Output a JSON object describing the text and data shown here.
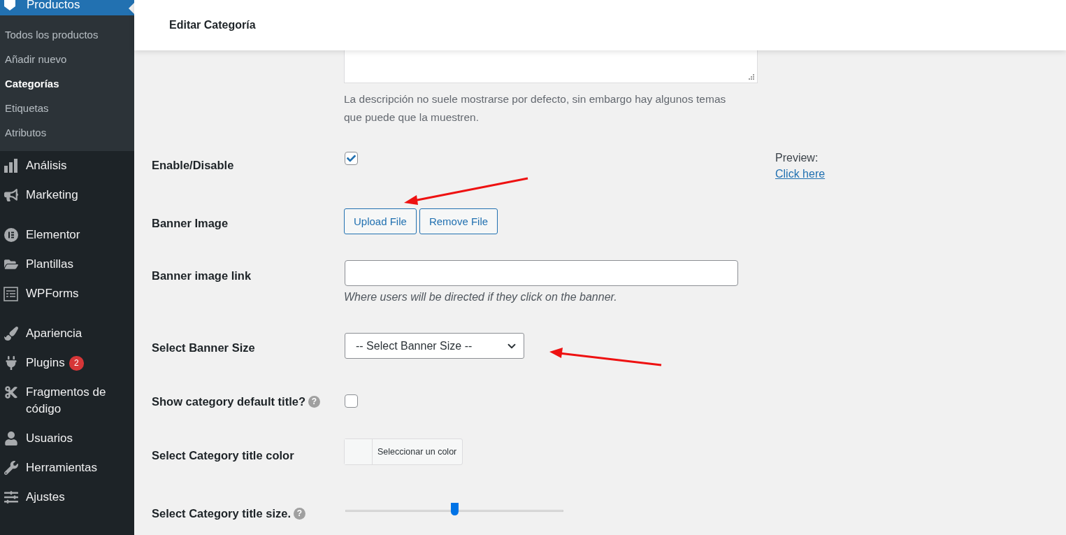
{
  "sidebar": {
    "current": {
      "label": "Productos"
    },
    "submenu": [
      {
        "label": "Todos los productos",
        "selected": false
      },
      {
        "label": "Añadir nuevo",
        "selected": false
      },
      {
        "label": "Categorías",
        "selected": true
      },
      {
        "label": "Etiquetas",
        "selected": false
      },
      {
        "label": "Atributos",
        "selected": false
      }
    ],
    "groups": [
      [
        {
          "label": "Análisis"
        },
        {
          "label": "Marketing"
        }
      ],
      [
        {
          "label": "Elementor"
        },
        {
          "label": "Plantillas"
        },
        {
          "label": "WPForms"
        }
      ],
      [
        {
          "label": "Apariencia"
        },
        {
          "label": "Plugins",
          "badge": "2"
        },
        {
          "label": "Fragmentos de código"
        },
        {
          "label": "Usuarios"
        },
        {
          "label": "Herramientas"
        },
        {
          "label": "Ajustes"
        }
      ]
    ]
  },
  "header": {
    "title": "Editar Categoría"
  },
  "description_hint": "La descripción no suele mostrarse por defecto, sin embargo hay algunos temas que puede que la muestren.",
  "fields": [
    {
      "kind": "checkbox",
      "label": "Enable/Disable",
      "checked": true,
      "preview": {
        "label": "Preview:",
        "link": "Click here"
      }
    },
    {
      "kind": "buttons",
      "label": "Banner Image",
      "buttons": [
        "Upload File",
        "Remove File"
      ]
    },
    {
      "kind": "text",
      "label": "Banner image link",
      "hint": "Where users will be directed if they click on the banner."
    },
    {
      "kind": "select",
      "label": "Select Banner Size",
      "value": "-- Select Banner Size --"
    },
    {
      "kind": "checkbox",
      "label": "Show category default title?",
      "help": "?",
      "checked": false
    },
    {
      "kind": "color",
      "label": "Select Category title color",
      "button": "Seleccionar un color"
    },
    {
      "kind": "slider",
      "label": "Select Category title size.",
      "help": "?",
      "level": 0.5
    }
  ]
}
